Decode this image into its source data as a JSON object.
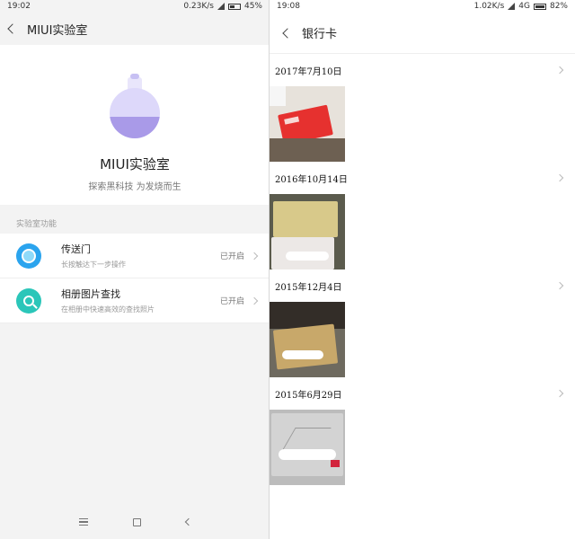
{
  "left": {
    "status": {
      "time": "19:02",
      "speed": "0.23K/s",
      "battery": "45%"
    },
    "header": {
      "title": "MIUI实验室"
    },
    "lab": {
      "title": "MIUI实验室",
      "subtitle": "探索黑科技 为发烧而生"
    },
    "section_label": "实验室功能",
    "features": [
      {
        "title": "传送门",
        "subtitle": "长按触达下一步操作",
        "status": "已开启",
        "icon": "portal-icon"
      },
      {
        "title": "相册图片查找",
        "subtitle": "在相册中快速高效的查找照片",
        "status": "已开启",
        "icon": "magnifier-icon"
      }
    ]
  },
  "right": {
    "status": {
      "time": "19:08",
      "speed": "1.02K/s",
      "network": "4G",
      "battery": "82%"
    },
    "header": {
      "title": "银行卡"
    },
    "groups": [
      {
        "date": "2017年7月10日"
      },
      {
        "date": "2016年10月14日"
      },
      {
        "date": "2015年12月4日"
      },
      {
        "date": "2015年6月29日"
      }
    ]
  },
  "colors": {
    "accent_blue": "#2ba4ee",
    "accent_teal": "#2bc6b9",
    "flask_purple": "#a99ae8"
  }
}
